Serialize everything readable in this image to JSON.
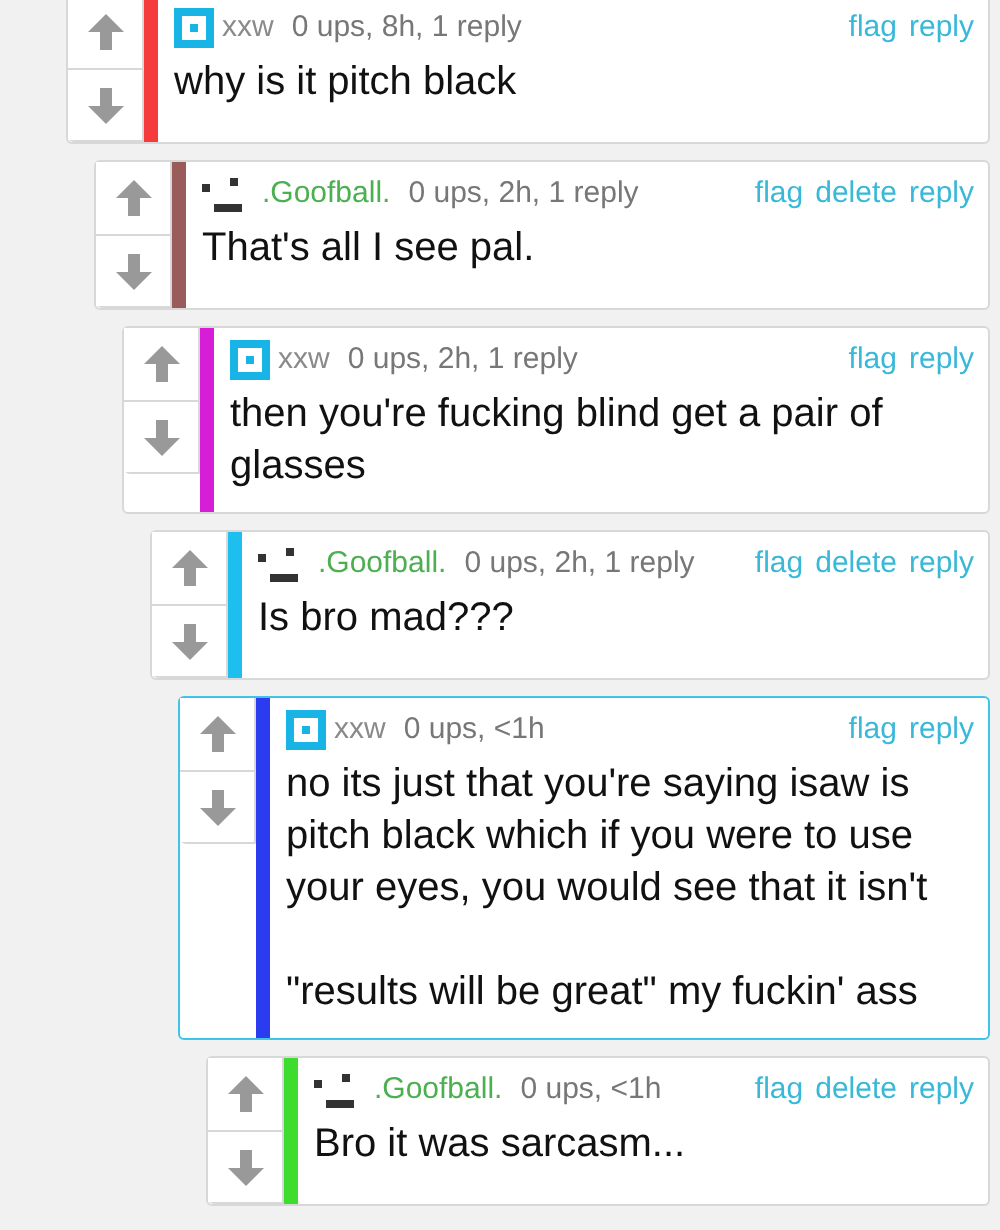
{
  "thread": [
    {
      "username": "xxw",
      "kind": "square",
      "meta": "0 ups, 8h, 1 reply",
      "actions": [
        "flag",
        "reply"
      ],
      "text": "why is it pitch black",
      "color": "#f53b3b",
      "highlighted": false,
      "children": [
        {
          "username": ".Goofball.",
          "kind": "face",
          "meta": "0 ups, 2h, 1 reply",
          "actions": [
            "flag",
            "delete",
            "reply"
          ],
          "text": "That's all I see pal.",
          "color": "#9a5b5b",
          "highlighted": false,
          "children": [
            {
              "username": "xxw",
              "kind": "square",
              "meta": "0 ups, 2h, 1 reply",
              "actions": [
                "flag",
                "reply"
              ],
              "text": "then you're fucking blind get a pair of glasses",
              "color": "#d61ed6",
              "highlighted": false,
              "children": [
                {
                  "username": ".Goofball.",
                  "kind": "face",
                  "meta": "0 ups, 2h, 1 reply",
                  "actions": [
                    "flag",
                    "delete",
                    "reply"
                  ],
                  "text": "Is bro mad???",
                  "color": "#1ebfee",
                  "highlighted": false,
                  "children": [
                    {
                      "username": "xxw",
                      "kind": "square",
                      "meta": "0 ups, <1h",
                      "actions": [
                        "flag",
                        "reply"
                      ],
                      "text": "no its just that you're saying isaw is pitch black which if you were to use your eyes, you would see that it isn't\n\n\"results will be great\" my fuckin' ass",
                      "color": "#2b3cf0",
                      "highlighted": true,
                      "children": [
                        {
                          "username": ".Goofball.",
                          "kind": "face",
                          "meta": "0 ups, <1h",
                          "actions": [
                            "flag",
                            "delete",
                            "reply"
                          ],
                          "text": "Bro it was sarcasm...",
                          "color": "#3ddc2e",
                          "highlighted": false
                        }
                      ]
                    }
                  ]
                }
              ]
            }
          ]
        }
      ]
    }
  ]
}
